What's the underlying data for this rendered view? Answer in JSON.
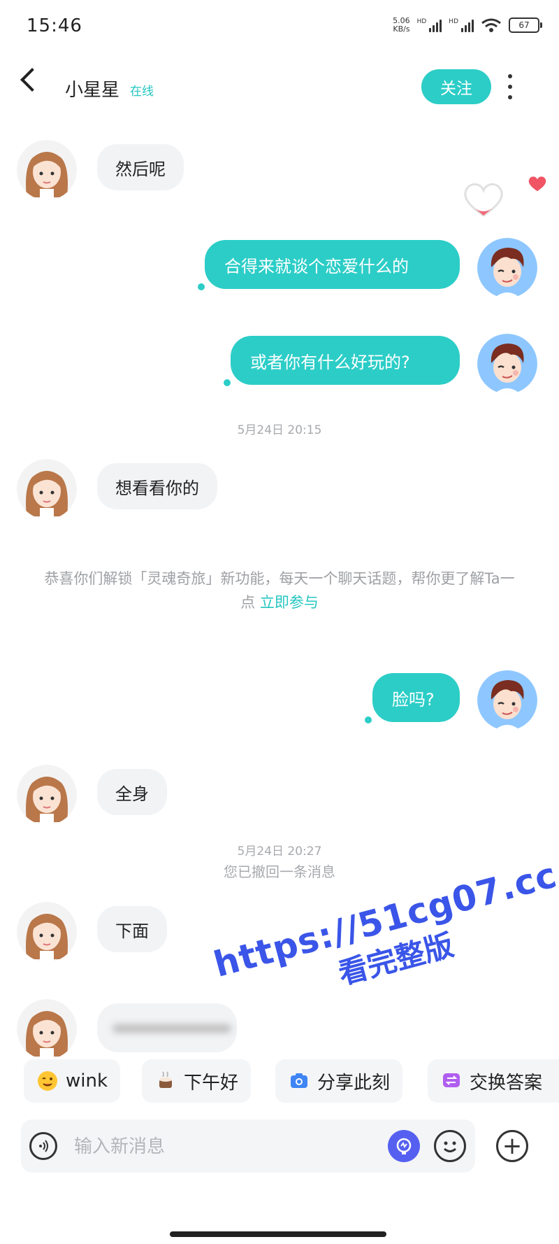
{
  "status_bar": {
    "time": "15:46",
    "net_speed_top": "5.06",
    "net_speed_bottom": "KB/s",
    "hd": "HD",
    "battery": "67"
  },
  "header": {
    "title": "小星星",
    "status": "在线",
    "follow_label": "关注"
  },
  "messages": [
    {
      "side": "in",
      "text": "然后呢"
    },
    {
      "side": "out",
      "text": "合得来就谈个恋爱什么的"
    },
    {
      "side": "out",
      "text": "或者你有什么好玩的?"
    },
    {
      "side": "in",
      "text": "想看看你的"
    },
    {
      "side": "out",
      "text": "脸吗?"
    },
    {
      "side": "in",
      "text": "全身"
    },
    {
      "side": "in",
      "text": "下面"
    }
  ],
  "time_separators": [
    "5月24日 20:15",
    "5月24日 20:27"
  ],
  "recall_notice": "您已撤回一条消息",
  "system_notice": {
    "text": "恭喜你们解锁「灵魂奇旅」新功能，每天一个聊天话题，帮你更了解Ta一点",
    "link": "立即参与"
  },
  "watermark": {
    "line1": "https://51cg07.cc",
    "line2": "看完整版"
  },
  "quick_replies": [
    {
      "label": "wink",
      "icon": "wink-emoji-icon"
    },
    {
      "label": "下午好",
      "icon": "coffee-icon"
    },
    {
      "label": "分享此刻",
      "icon": "camera-icon"
    },
    {
      "label": "交换答案",
      "icon": "exchange-icon"
    }
  ],
  "input": {
    "placeholder": "输入新消息"
  },
  "colors": {
    "accent": "#2ccdc7",
    "bubble_in": "#f2f3f5",
    "watermark": "#3a55e8"
  }
}
